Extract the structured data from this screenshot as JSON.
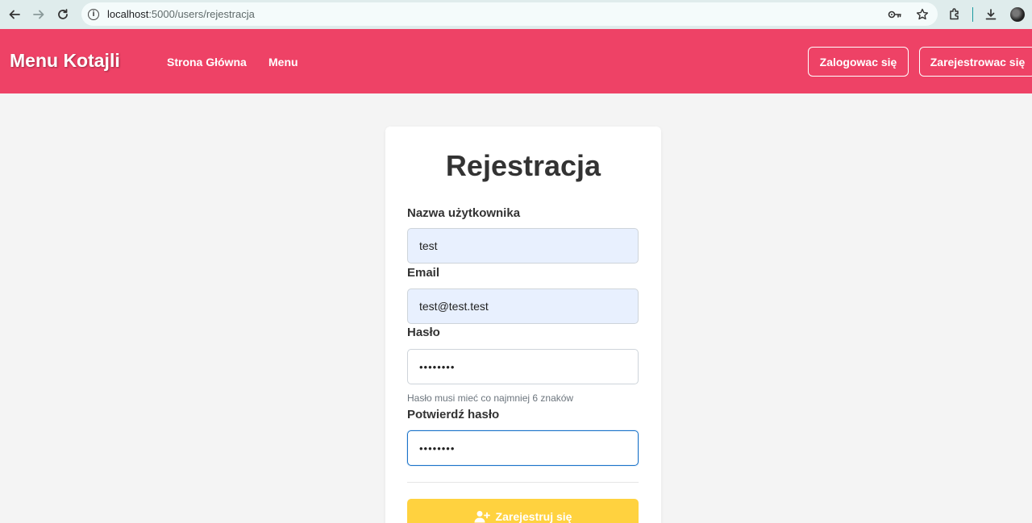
{
  "browser": {
    "url_host": "localhost",
    "url_path": ":5000/users/rejestracja"
  },
  "navbar": {
    "brand": "Menu Kotajli",
    "links": [
      "Strona Główna",
      "Menu"
    ],
    "login_label": "Zalogowac się",
    "register_label": "Zarejestrowac się",
    "color": "#ee4266"
  },
  "form": {
    "title": "Rejestracja",
    "username_label": "Nazwa użytkownika",
    "username_value": "test",
    "email_label": "Email",
    "email_value": "test@test.test",
    "password_label": "Hasło",
    "password_value": "••••••••",
    "password_help": "Hasło musi mieć co najmniej 6 znaków",
    "confirm_label": "Potwierdź hasło",
    "confirm_value": "••••••••",
    "submit_label": "Zarejestruj się",
    "submit_color": "#ffd23f"
  }
}
